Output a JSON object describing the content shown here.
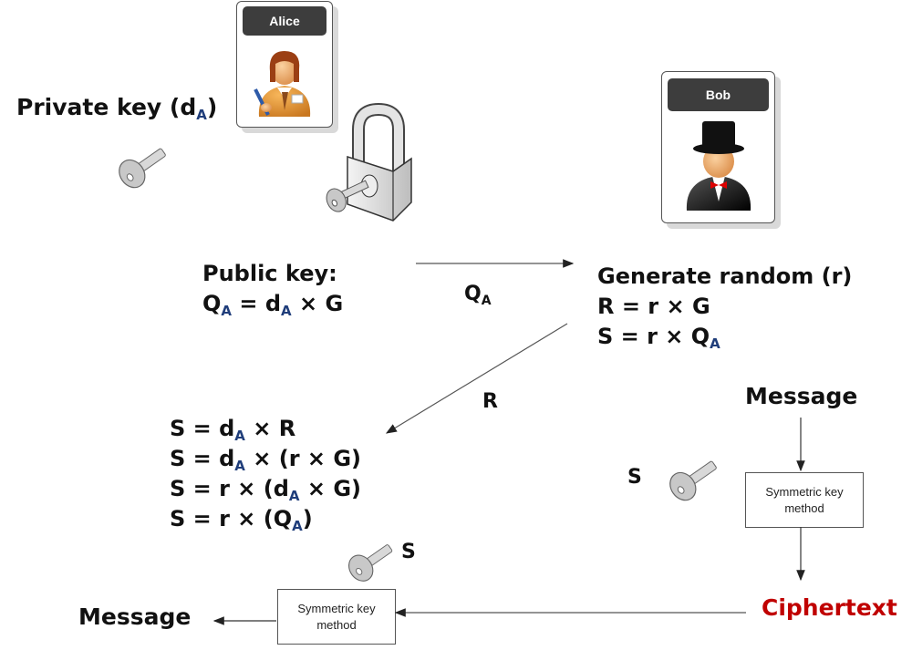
{
  "alice": {
    "name": "Alice",
    "icon": "woman-writer-icon"
  },
  "bob": {
    "name": "Bob",
    "icon": "man-top-hat-icon"
  },
  "private_key": {
    "label": "Private key (d",
    "sub": "A",
    "close": ")",
    "icon": "key-icon"
  },
  "lock": {
    "icon": "padlock-key-icon"
  },
  "public_key": {
    "line1": "Public key:",
    "line2_q": "Q",
    "line2_q_sub": "A",
    "line2_mid": " = d",
    "line2_d_sub": "A",
    "line2_end": " × G"
  },
  "arrow_qa": {
    "label": "Q",
    "sub": "A"
  },
  "bob_steps": {
    "line1": "Generate random (r)",
    "line2": "R = r × G",
    "line3_pre": "S = r × Q",
    "line3_sub": "A"
  },
  "arrow_r": {
    "label": "R"
  },
  "alice_steps": [
    {
      "pre": "S = d",
      "sub": "A",
      "post": " × R"
    },
    {
      "pre": "S = d",
      "sub": "A",
      "post": " × (r × G)"
    },
    {
      "pre": "S = r × (d",
      "sub": "A",
      "post": "  × G)"
    },
    {
      "pre": "S = r × (Q",
      "sub": "A",
      "post": ")"
    }
  ],
  "bob_message": "Message",
  "bob_key_label": "S",
  "bob_symbox": {
    "line1": "Symmetric key",
    "line2": "method"
  },
  "ciphertext": {
    "label": "Ciphertext",
    "color": "#c00000"
  },
  "alice_key_label": "S",
  "alice_symbox": {
    "line1": "Symmetric key",
    "line2": "method"
  },
  "alice_message": "Message"
}
